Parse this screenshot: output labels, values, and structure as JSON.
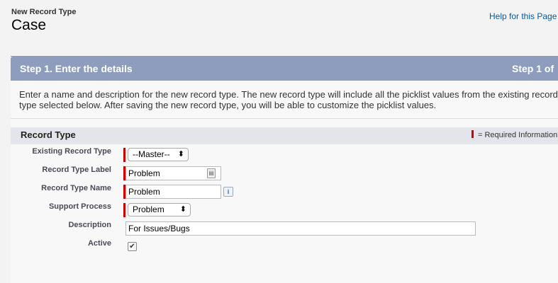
{
  "header": {
    "subtitle": "New Record Type",
    "title": "Case",
    "help_link": "Help for this Page"
  },
  "step": {
    "title": "Step 1. Enter the details",
    "count": "Step 1 of"
  },
  "intro_text": "Enter a name and description for the new record type. The new record type will include all the picklist values from the existing record type selected below. After saving the new record type, you will be able to customize the picklist values.",
  "section": {
    "title": "Record Type",
    "required_legend": "= Required Information"
  },
  "form": {
    "existing_record_type": {
      "label": "Existing Record Type",
      "value": "--Master--"
    },
    "record_type_label": {
      "label": "Record Type Label",
      "value": "Problem"
    },
    "record_type_name": {
      "label": "Record Type Name",
      "value": "Problem"
    },
    "support_process": {
      "label": "Support Process",
      "value": "Problem"
    },
    "description": {
      "label": "Description",
      "value": "For Issues/Bugs"
    },
    "active": {
      "label": "Active",
      "checked": true
    }
  },
  "colors": {
    "step_bar": "#8e9dbe",
    "required": "#cc0000",
    "link": "#015ba7"
  }
}
